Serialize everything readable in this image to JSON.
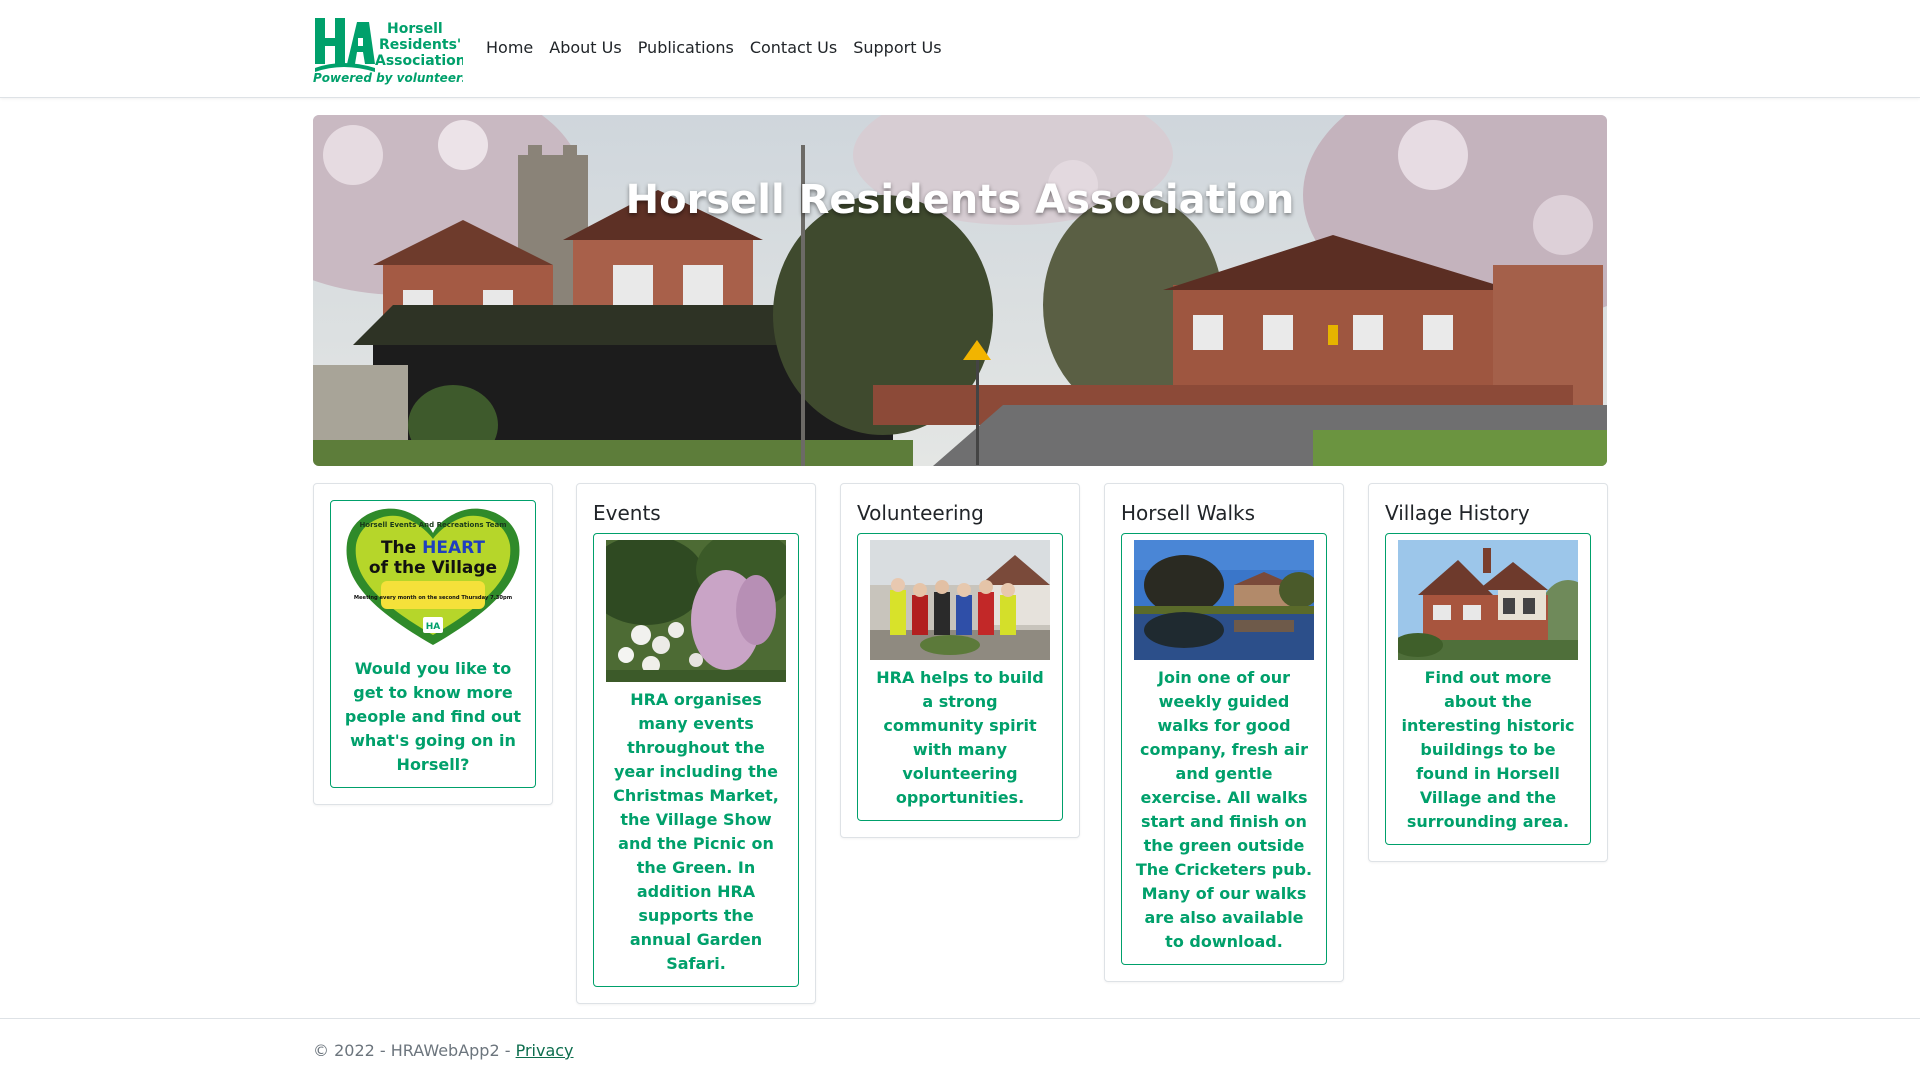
{
  "brand": {
    "logo_line1": "Horsell",
    "logo_line2": "Residents'",
    "logo_line3": "Association",
    "logo_tagline": "Powered by volunteers",
    "green": "#00a06b"
  },
  "nav": {
    "items": [
      {
        "label": "Home"
      },
      {
        "label": "About Us"
      },
      {
        "label": "Publications"
      },
      {
        "label": "Contact Us"
      },
      {
        "label": "Support Us"
      }
    ]
  },
  "hero": {
    "title": "Horsell Residents Association"
  },
  "cards": [
    {
      "title": "",
      "badge_top": "Horsell Events And Recreations Team",
      "badge_heart1": "The ",
      "badge_heart2": "HEART",
      "badge_heart3": "of the Village",
      "badge_meeting": "Meeting every month on the second Thursday 7.30pm",
      "text": "Would you like to get to know more people and find out what's going on in Horsell?"
    },
    {
      "title": "Events",
      "text": "HRA organises many events throughout the year including the Christmas Market, the Village Show and the Picnic on the Green. In addition HRA supports the annual Garden Safari."
    },
    {
      "title": "Volunteering",
      "text": "HRA helps to build a strong community spirit with many volunteering opportunities."
    },
    {
      "title": "Horsell Walks",
      "text": "Join one of our weekly guided walks for good company, fresh air and gentle exercise. All walks start and finish on the green outside The Cricketers pub. Many of our walks are also available to download."
    },
    {
      "title": "Village History",
      "text": "Find out more about the interesting historic buildings to be found in Horsell Village and the surrounding area."
    }
  ],
  "footer": {
    "copyright": "© 2022 - HRAWebApp2 - ",
    "privacy_label": "Privacy"
  }
}
